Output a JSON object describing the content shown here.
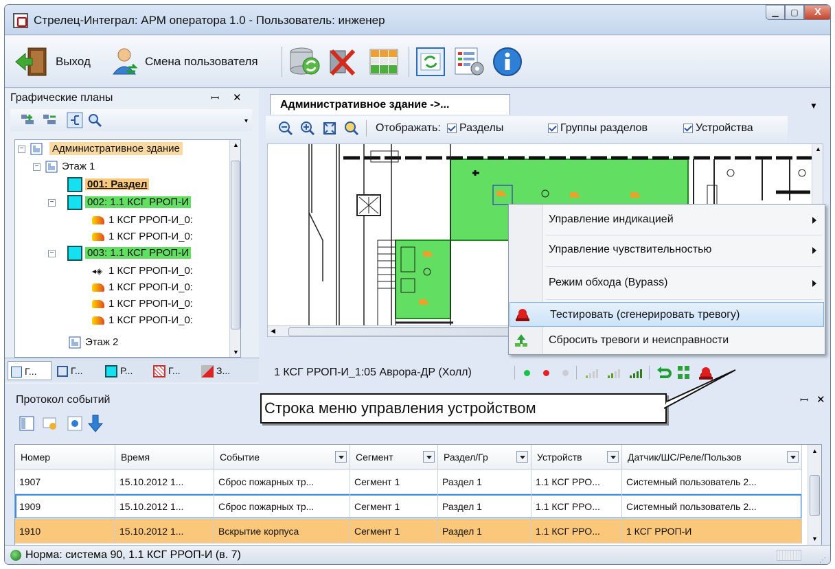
{
  "window": {
    "title": "Стрелец-Интеграл: АРМ оператора 1.0 - Пользователь: инженер",
    "minimize_glyph": "▁",
    "maximize_glyph": "▢",
    "close_glyph": "X"
  },
  "toolbar": {
    "exit_label": "Выход",
    "change_user_label": "Смена пользователя"
  },
  "left_panel": {
    "title": "Графические планы",
    "pin_glyph": "ꟷ",
    "close_glyph": "✕",
    "tree": [
      {
        "label": "Административное здание",
        "type": "building"
      },
      {
        "label": "Этаж 1",
        "type": "floor"
      },
      {
        "label": "001: Раздел",
        "type": "section"
      },
      {
        "label": "002: 1.1 КСГ РРОП-И",
        "type": "section"
      },
      {
        "label": "1 КСГ РРОП-И_0:",
        "type": "device"
      },
      {
        "label": "1 КСГ РРОП-И_0:",
        "type": "device"
      },
      {
        "label": "003: 1.1 КСГ РРОП-И",
        "type": "section"
      },
      {
        "label": "1 КСГ РРОП-И_0:",
        "type": "device"
      },
      {
        "label": "1 КСГ РРОП-И_0:",
        "type": "device"
      },
      {
        "label": "1 КСГ РРОП-И_0:",
        "type": "device"
      },
      {
        "label": "1 КСГ РРОП-И_0:",
        "type": "device"
      },
      {
        "label": "Этаж 2",
        "type": "floor"
      }
    ],
    "tabs": [
      "Г...",
      "Г...",
      "Р...",
      "Г...",
      "З..."
    ]
  },
  "document": {
    "tab_title": "Административное здание ->...",
    "show_label": "Отображать:",
    "check_sections": "Разделы",
    "check_groups": "Группы разделов",
    "check_devices": "Устройства"
  },
  "context_menu": {
    "items": [
      {
        "label": "Управление индикацией",
        "submenu": true
      },
      {
        "label": "Управление чувствительностью",
        "submenu": true
      },
      {
        "label": "Режим обхода (Bypass)",
        "submenu": true
      },
      {
        "label": "Тестировать (сгенерировать тревогу)",
        "highlighted": true
      },
      {
        "label": "Сбросить тревоги и неисправности"
      }
    ]
  },
  "device_bar": {
    "device_label": "1 КСГ РРОП-И_1:05 Аврора-ДР (Холл)"
  },
  "callout": {
    "text": "Строка меню управления устройством"
  },
  "events": {
    "title": "Протокол событий",
    "columns": [
      "Номер",
      "Время",
      "Событие",
      "Сегмент",
      "Раздел/Гр",
      "Устройств",
      "Датчик/ШС/Реле/Пользов"
    ],
    "rows": [
      [
        "1907",
        "15.10.2012 1...",
        "Сброс пожарных тр...",
        "Сегмент 1",
        "Раздел 1",
        "1.1 КСГ РРО...",
        "Системный пользователь 2..."
      ],
      [
        "1909",
        "15.10.2012 1...",
        "Сброс пожарных тр...",
        "Сегмент 1",
        "Раздел 1",
        "1.1 КСГ РРО...",
        "Системный пользователь 2..."
      ],
      [
        "1910",
        "15.10.2012 1...",
        "Вскрытие корпуса",
        "Сегмент 1",
        "Раздел 1",
        "1.1 КСГ РРО...",
        "1 КСГ РРОП-И"
      ]
    ]
  },
  "status": {
    "text": "Норма: система 90, 1.1 КСГ РРОП-И (в. 7)"
  },
  "colors": {
    "section_green": "#62de62",
    "section_cyan": "#14e0f0",
    "selected_orange": "#fbc77b",
    "menu_highlight": "#cde3f8"
  }
}
